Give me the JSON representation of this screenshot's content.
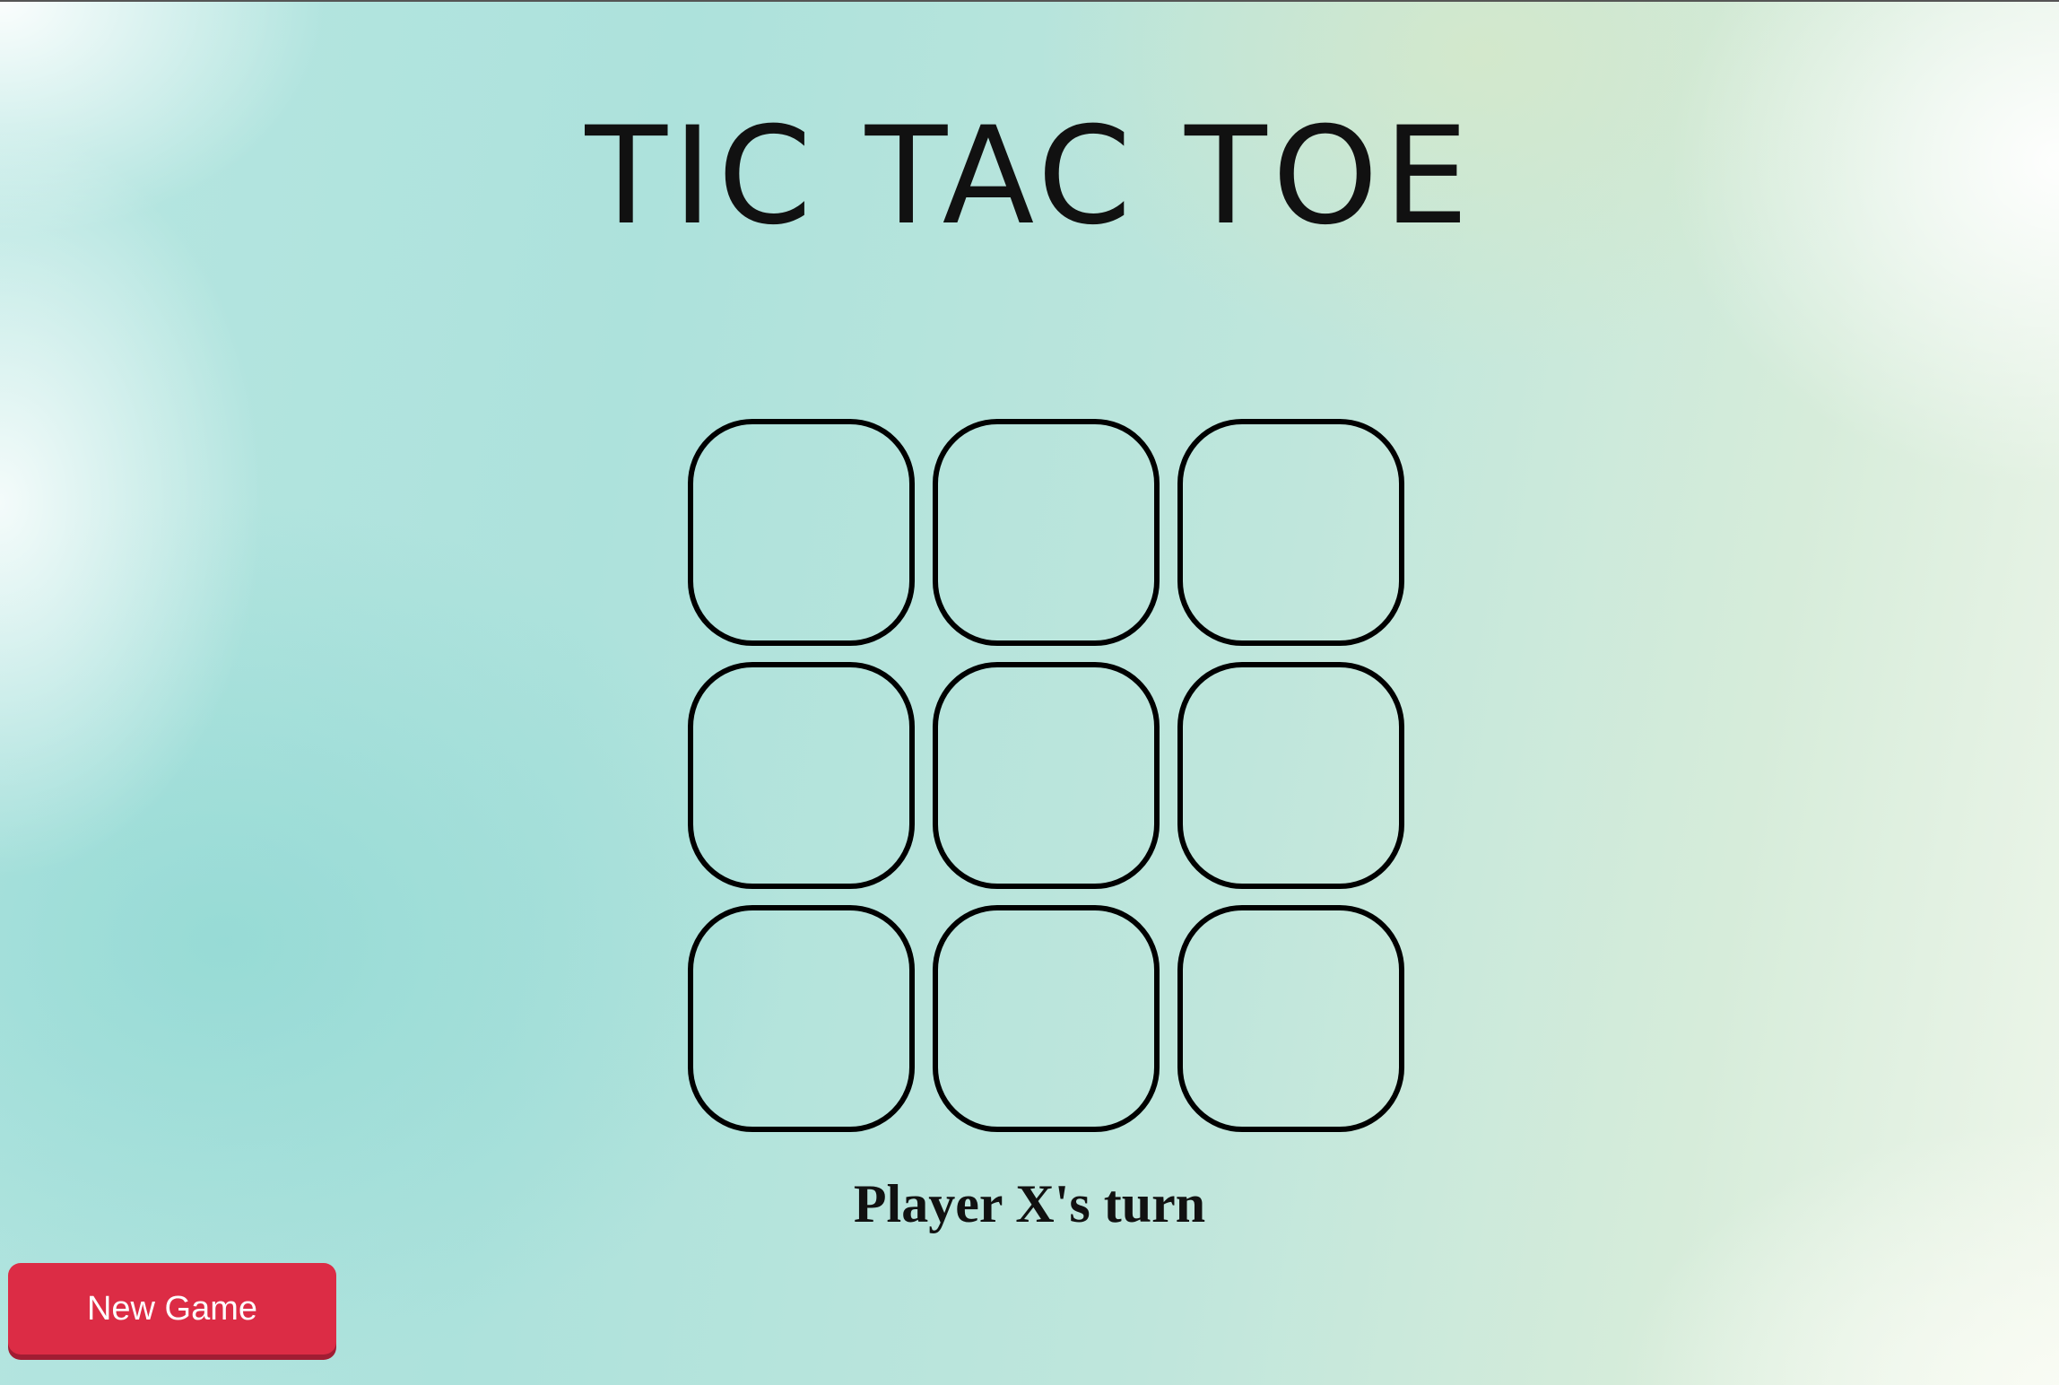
{
  "title": "TIC TAC TOE",
  "board": {
    "cells": [
      "",
      "",
      "",
      "",
      "",
      "",
      "",
      "",
      ""
    ]
  },
  "status": "Player X's turn",
  "controls": {
    "new_game_label": "New Game"
  },
  "colors": {
    "button_bg": "#dc2c45",
    "cell_border": "#000000",
    "text": "#111111"
  }
}
